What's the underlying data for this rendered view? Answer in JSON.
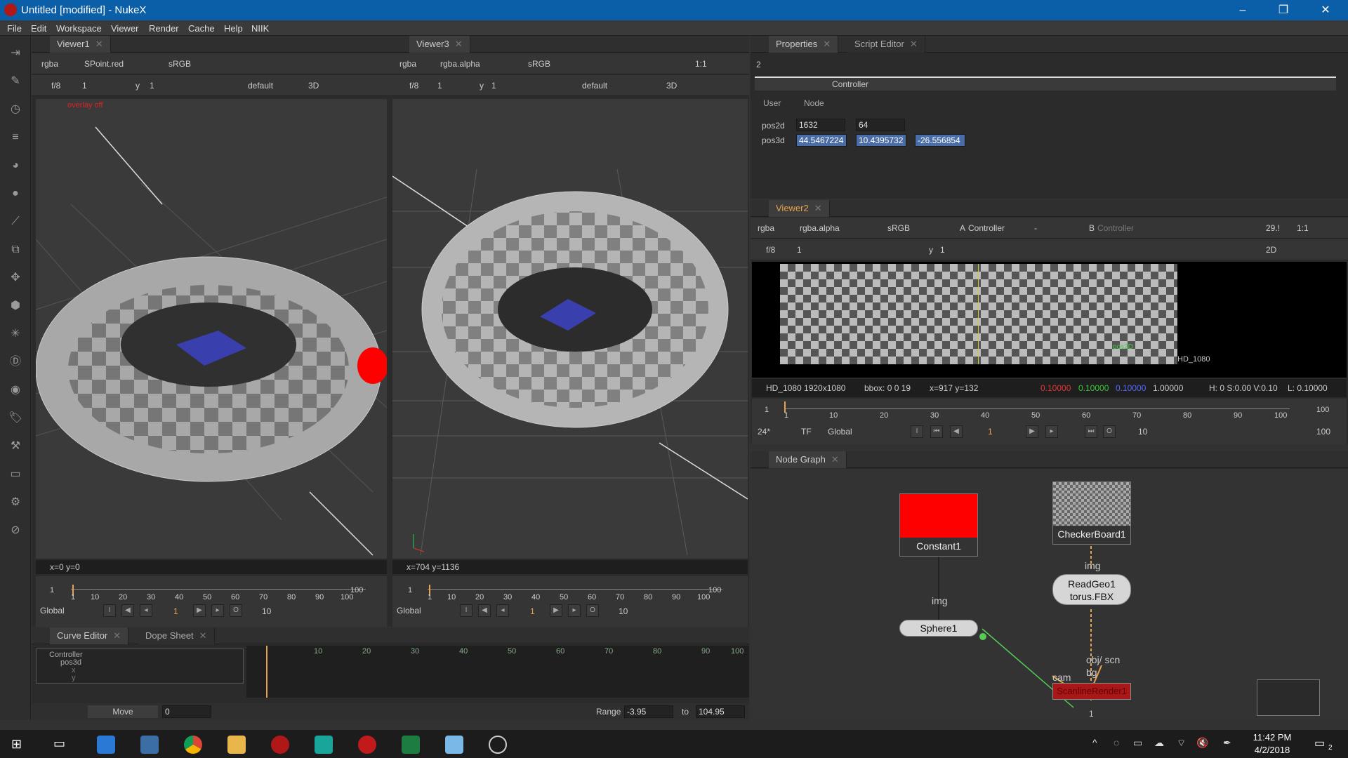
{
  "window": {
    "title": "Untitled [modified] - NukeX",
    "controls": [
      "–",
      "❐",
      "✕"
    ]
  },
  "menu": [
    "File",
    "Edit",
    "Workspace",
    "Viewer",
    "Render",
    "Cache",
    "Help",
    "NIIK"
  ],
  "viewer1": {
    "tab": "Viewer1",
    "channels": "rgba",
    "layer": "SPoint.red",
    "colorspace": "sRGB",
    "frame_label": "f/8",
    "frame_val": "1",
    "y_label": "y",
    "y_val": "1",
    "lut": "default",
    "mode": "3D",
    "overlay": "overlay off",
    "status": "x=0 y=0",
    "timeline": {
      "start": "1",
      "end": "100",
      "ticks": [
        "1",
        "10",
        "20",
        "30",
        "40",
        "50",
        "60",
        "70",
        "80",
        "90",
        "100"
      ],
      "current": "1",
      "scope": "Global",
      "step": "10"
    }
  },
  "viewer3": {
    "tab": "Viewer3",
    "channels": "rgba",
    "layer": "rgba.alpha",
    "colorspace": "sRGB",
    "zoom": "1:1",
    "frame_label": "f/8",
    "frame_val": "1",
    "y_label": "y",
    "y_val": "1",
    "lut": "default",
    "mode": "3D",
    "status": "x=704 y=1136",
    "timeline": {
      "start": "1",
      "end": "100",
      "ticks": [
        "1",
        "10",
        "20",
        "30",
        "40",
        "50",
        "60",
        "70",
        "80",
        "90",
        "100"
      ],
      "current": "1",
      "scope": "Global",
      "step": "10"
    }
  },
  "curve_panel": {
    "tabs": [
      "Curve Editor",
      "Dope Sheet"
    ],
    "tree": [
      "Controller",
      "pos3d",
      "x",
      "y"
    ],
    "ticks": [
      "10",
      "20",
      "30",
      "40",
      "50",
      "60",
      "70",
      "80",
      "90",
      "100"
    ],
    "move_label": "Move",
    "move_val": "0",
    "range_label": "Range",
    "range_from": "-3.95",
    "range_to_label": "to",
    "range_to": "104.95"
  },
  "properties": {
    "tabs": [
      "Properties",
      "Script Editor"
    ],
    "count": "2",
    "node_name": "Controller",
    "subtabs": [
      "User",
      "Node"
    ],
    "pos2d": {
      "label": "pos2d",
      "x": "1632",
      "y": "64"
    },
    "pos3d": {
      "label": "pos3d",
      "x": "44.5467224",
      "y": "10.4395732",
      "z": "-26.556854"
    }
  },
  "viewer2": {
    "tab": "Viewer2",
    "channels": "rgba",
    "layer": "rgba.alpha",
    "colorspace": "sRGB",
    "a_input": "Controller",
    "dash": "-",
    "b_label": "B",
    "b_input": "Controller",
    "a_label": "A",
    "fps": "29.!",
    "zoom": "1:1",
    "frame_label": "f/8",
    "frame_val": "1",
    "y_label": "y",
    "y_val": "1",
    "mode": "2D",
    "format_label": "HD_1080",
    "pos_label": "pos2D",
    "status": {
      "format": "HD_1080 1920x1080",
      "bbox": "bbox: 0 0 19",
      "coords": "x=917 y=132",
      "r": "0.10000",
      "g": "0.10000",
      "b": "0.10000",
      "a": "1.00000",
      "hsv": "H:  0 S:0.00 V:0.10",
      "lum": "L: 0.10000"
    },
    "timeline": {
      "start": "1",
      "end": "100",
      "ticks": [
        "1",
        "10",
        "20",
        "30",
        "40",
        "50",
        "60",
        "70",
        "80",
        "90",
        "100"
      ],
      "fps": "24*",
      "tf": "TF",
      "scope": "Global",
      "current": "1",
      "step": "10",
      "end_field": "100"
    }
  },
  "node_graph": {
    "tab": "Node Graph",
    "nodes": {
      "constant": "Constant1",
      "checker": "CheckerBoard1",
      "readgeo": "ReadGeo1\ntorus.FBX",
      "sphere": "Sphere1",
      "render": "ScanlineRender1"
    },
    "labels": {
      "img1": "img",
      "img2": "img",
      "cam": "cam",
      "obj": "obj/ scn",
      "bg": "bg",
      "one": "1"
    }
  },
  "taskbar": {
    "time": "11:42 PM",
    "date": "4/2/2018",
    "notif": "2"
  },
  "colors": {
    "accent": "#0a5fa8",
    "red": "#ff0000",
    "orange": "#e8a34a",
    "highlight": "#4a6da8"
  }
}
